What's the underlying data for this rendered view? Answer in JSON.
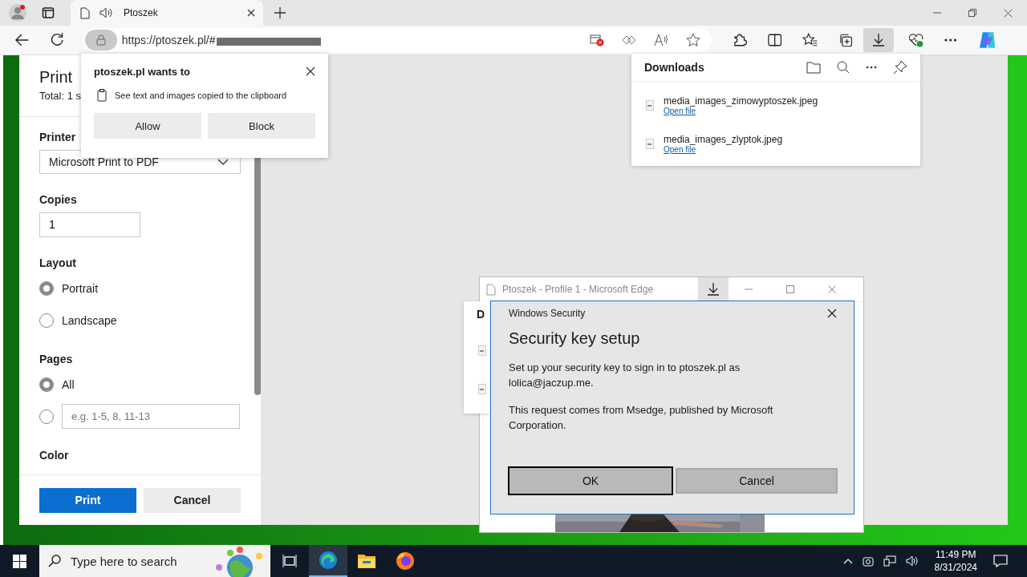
{
  "browser": {
    "tabs": [
      {
        "title": "Ptoszek",
        "selected": true
      }
    ],
    "url": "https://ptoszek.pl/#",
    "downloads_button": {
      "active": true
    }
  },
  "permission_popup": {
    "title": "ptoszek.pl wants to",
    "item": "See text and images copied to the clipboard",
    "buttons": [
      "Allow",
      "Block"
    ]
  },
  "print": {
    "title": "Print",
    "total": "Total: 1 s",
    "printer_label": "Printer",
    "printer": "Microsoft Print to PDF",
    "copies_label": "Copies",
    "copies": "1",
    "layout_label": "Layout",
    "layout_options": [
      {
        "label": "Portrait",
        "selected": true
      },
      {
        "label": "Landscape",
        "selected": false
      }
    ],
    "pages_label": "Pages",
    "pages_options": [
      {
        "kind": "label",
        "label": "All",
        "selected": true
      },
      {
        "kind": "range",
        "placeholder": "e.g. 1-5, 8, 11-13",
        "selected": false
      }
    ],
    "color_label": "Color",
    "buttons": [
      {
        "label": "Print",
        "kind": "primary"
      },
      {
        "label": "Cancel",
        "kind": "secondary"
      }
    ]
  },
  "downloads": {
    "title": "Downloads",
    "items": [
      {
        "name": "media_images_zimowyptoszek.jpeg",
        "action": "Open file"
      },
      {
        "name": "media_images_zlyptok.jpeg",
        "action": "Open file"
      }
    ]
  },
  "edge_window": {
    "title": "Ptoszek - Profile 1 - Microsoft Edge",
    "downloads_title": "D"
  },
  "security_dialog": {
    "caption": "Windows Security",
    "title": "Security key setup",
    "paragraphs": [
      "Set up your security key to sign in to ptoszek.pl as lolica@jaczup.me.",
      "This request comes from Msedge, published by Microsoft Corporation."
    ],
    "buttons": [
      {
        "label": "OK",
        "default": true
      },
      {
        "label": "Cancel",
        "default": false
      }
    ]
  },
  "taskbar": {
    "search_placeholder": "Type here to search",
    "apps": [
      {
        "kind": "taskview",
        "active": false
      },
      {
        "kind": "edge",
        "active": true
      },
      {
        "kind": "explorer",
        "active": false
      },
      {
        "kind": "firefox",
        "active": false
      }
    ],
    "time": "11:49 PM",
    "date": "8/31/2024"
  }
}
